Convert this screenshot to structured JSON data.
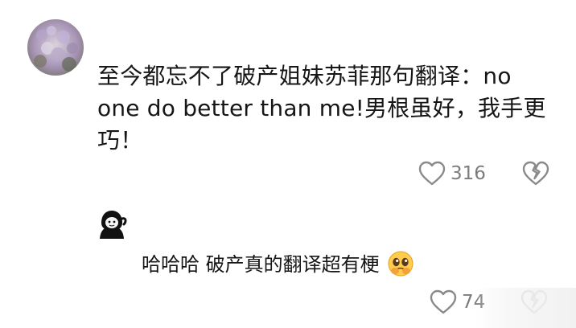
{
  "comment": {
    "text": "至今都忘不了破产姐妹苏菲那句翻译：no one do better than me!男根虽好，我手更巧！",
    "likes": "316",
    "avatar_icon": "lilac-flowers-avatar"
  },
  "reply": {
    "text": "哈哈哈 破产真的翻译超有梗",
    "emoji": "pleading-face-emoji",
    "likes": "74",
    "avatar_icon": "cartoon-character-avatar"
  },
  "colors": {
    "text": "#161616",
    "muted": "#7c7c7c",
    "icon_stroke": "#8a8a8a"
  }
}
